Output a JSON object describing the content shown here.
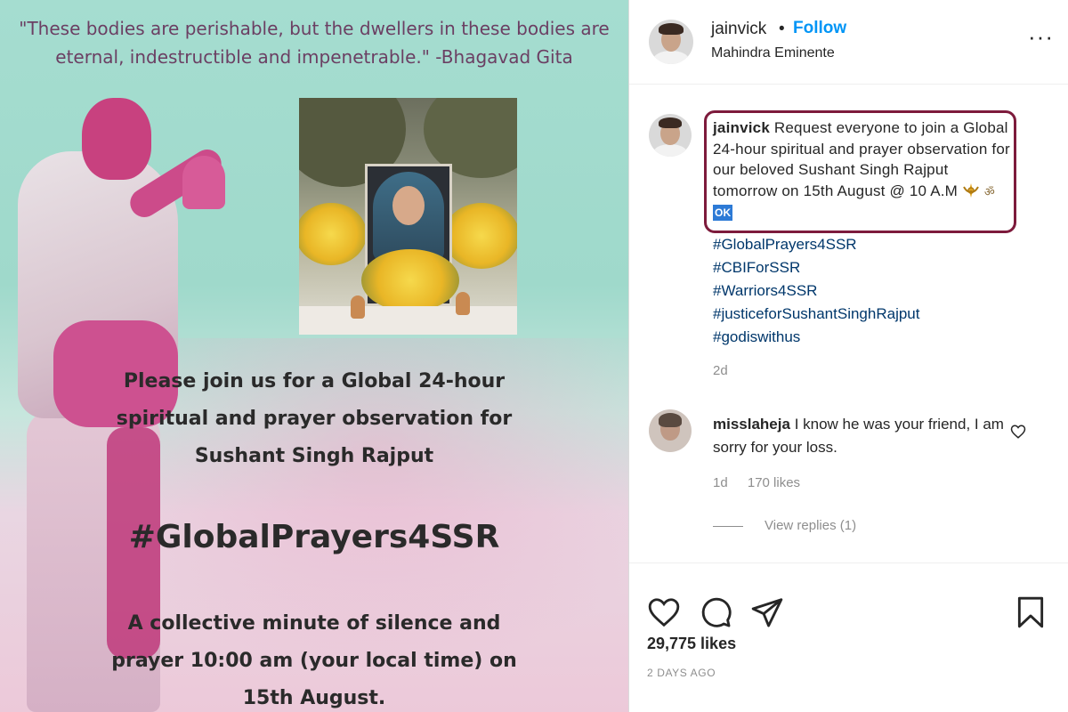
{
  "post_image": {
    "quote_line1": "\"These bodies are perishable, but the dwellers in these bodies are",
    "quote_line2": "eternal, indestructible and impenetrable.\" -Bhagavad Gita",
    "join_line1": "Please join us for a Global 24-hour",
    "join_line2": "spiritual and prayer observation for",
    "join_line3": "Sushant Singh Rajput",
    "hashtag": "#GlobalPrayers4SSR",
    "minute_line1": "A collective minute of silence and",
    "minute_line2": "prayer 10:00 am (your local time) on",
    "minute_line3": "15th August."
  },
  "header": {
    "username": "jainvick",
    "separator": "•",
    "follow_label": "Follow",
    "location": "Mahindra Eminente",
    "more_label": "···"
  },
  "caption": {
    "username": "jainvick",
    "text": "Request everyone to join a Global 24-hour spiritual and prayer observation for our beloved Sushant Singh Rajput tomorrow on 15th August @ 10 A.M",
    "emoji_om": "ॐ",
    "emoji_ok": "OK",
    "hashtags": [
      "#GlobalPrayers4SSR",
      "#CBIForSSR",
      "#Warriors4SSR",
      "#justiceforSushantSinghRajput",
      "#godiswithus"
    ],
    "time": "2d"
  },
  "comment": {
    "username": "misslaheja",
    "text": "I know he was your friend, I am sorry for your loss.",
    "time": "1d",
    "likes": "170 likes",
    "view_replies": "View replies (1)"
  },
  "actions": {
    "likes": "29,775 likes",
    "posted": "2 DAYS AGO"
  },
  "colors": {
    "follow": "#0095f6",
    "hashtag": "#00376b",
    "highlight_border": "#7d1b3c",
    "muted": "#8e8e8e"
  },
  "icons": [
    "heart-icon",
    "comment-icon",
    "share-icon",
    "bookmark-icon",
    "more-options-icon",
    "comment-like-icon"
  ]
}
